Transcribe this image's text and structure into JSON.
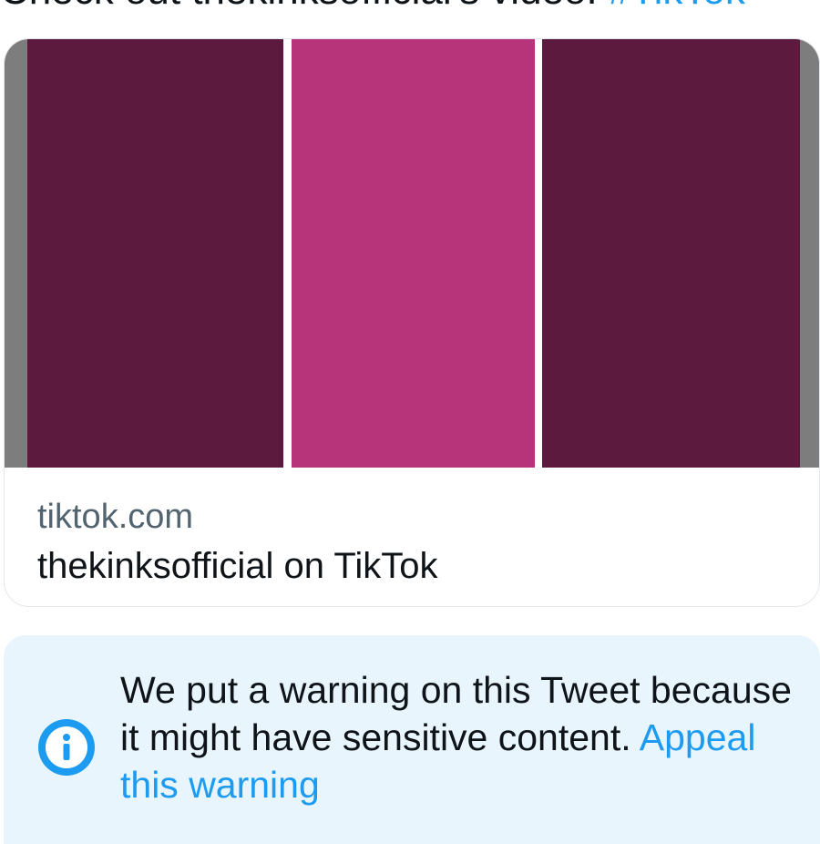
{
  "tweet": {
    "text": "Check out thekinksofficial's video!",
    "hashtag": "#TikTok"
  },
  "link_card": {
    "domain": "tiktok.com",
    "title": "thekinksofficial on TikTok",
    "panel_colors": [
      "#5c1a3e",
      "#b7347a",
      "#5c1a3e"
    ]
  },
  "warning": {
    "icon": "info-icon",
    "message": "We put a warning on this Tweet because it might have sensitive content.",
    "appeal_link": "Appeal this warning",
    "accent_color": "#1d9bf0",
    "background_color": "#e8f5fd"
  }
}
